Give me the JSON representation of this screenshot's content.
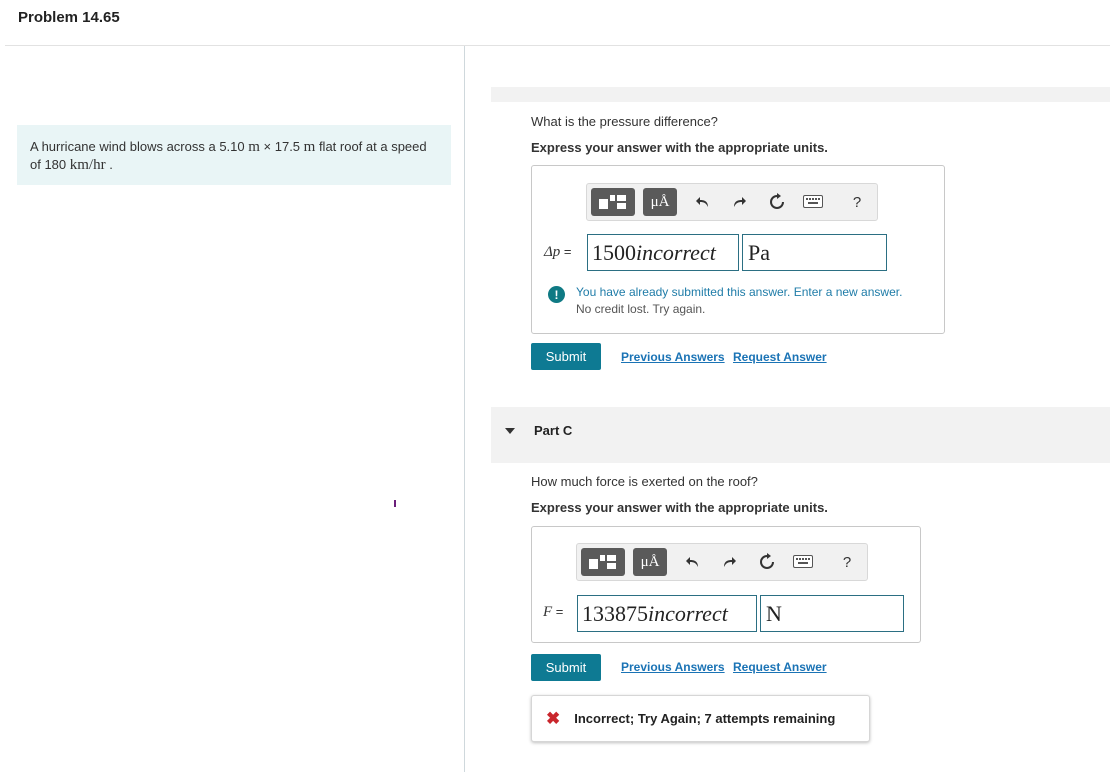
{
  "header": {
    "title": "Problem 14.65"
  },
  "problem": {
    "text_before": "A hurricane wind blows across a 5.10 ",
    "unit_m1": "m",
    "times": " × ",
    "dim2": "17.5 ",
    "unit_m2": "m",
    "text_mid": " flat roof at a speed of 180 ",
    "speed_unit": "km/hr",
    "text_end": " ."
  },
  "partB": {
    "question": "What is the pressure difference?",
    "instruction": "Express your answer with the appropriate units.",
    "toolbar": {
      "templates_icon": "templates-icon",
      "units_label": "μÅ",
      "undo_icon": "undo-icon",
      "redo_icon": "redo-icon",
      "reset_icon": "reset-icon",
      "keyboard_icon": "keyboard-icon",
      "help_label": "?"
    },
    "variable_symbol": "Δp",
    "equals": " =",
    "value_number": "1500",
    "value_status": "incorrect",
    "unit": "Pa",
    "warning_line1": "You have already submitted this answer. Enter a new answer.",
    "warning_line2": "No credit lost. Try again.",
    "submit_label": "Submit",
    "previous_answers_label": "Previous Answers",
    "request_answer_label": "Request Answer"
  },
  "partC": {
    "title": "Part C",
    "question": "How much force is exerted on the roof?",
    "instruction": "Express your answer with the appropriate units.",
    "toolbar": {
      "units_label": "μÅ",
      "help_label": "?"
    },
    "variable_symbol": "F",
    "equals": " =",
    "value_number": "133875",
    "value_status": "incorrect",
    "unit": "N",
    "submit_label": "Submit",
    "previous_answers_label": "Previous Answers",
    "request_answer_label": "Request Answer",
    "feedback": "Incorrect; Try Again; 7 attempts remaining",
    "feedback_icon": "✖"
  },
  "colors": {
    "accent": "#0e7a93",
    "problem_bg": "#e9f5f6",
    "error": "#c9262c",
    "link": "#1a73b5"
  }
}
